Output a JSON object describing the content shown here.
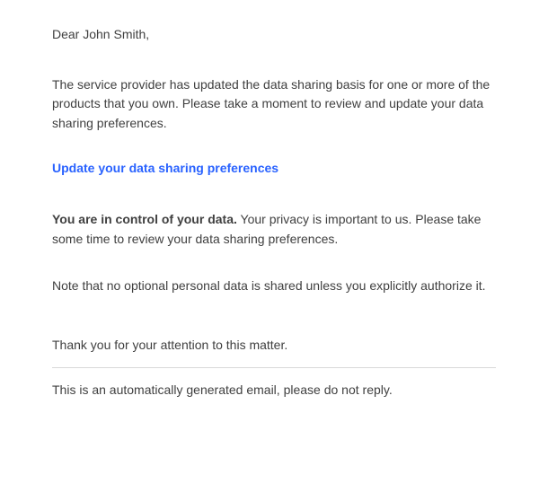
{
  "greeting": "Dear John Smith,",
  "intro": "The service provider has updated the data sharing basis for one or more of the products that you own. Please take a moment to review and update your data sharing preferences.",
  "link_text": "Update your data sharing preferences",
  "control_bold": "You are in control of your data.",
  "control_rest": " Your privacy is important to us. Please take some time to review your data sharing preferences.",
  "note": "Note that no optional personal data is shared unless you explicitly authorize it.",
  "closing": "Thank you for your attention to this matter.",
  "footer": "This is an automatically generated email, please do not reply."
}
